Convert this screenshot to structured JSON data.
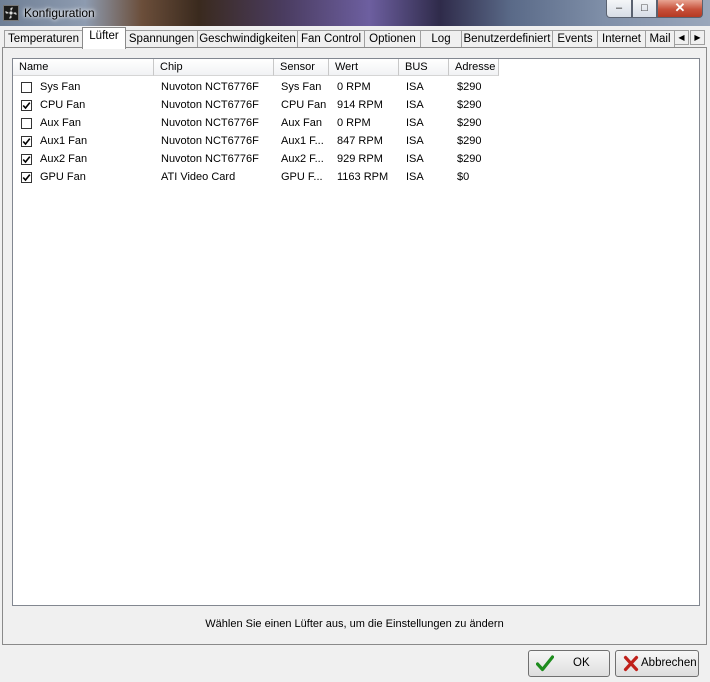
{
  "window": {
    "title": "Konfiguration",
    "minimize": "–",
    "maximize": "□",
    "close": "✕"
  },
  "tabs": [
    {
      "label": "Temperaturen",
      "active": false
    },
    {
      "label": "Lüfter",
      "active": true
    },
    {
      "label": "Spannungen",
      "active": false
    },
    {
      "label": "Geschwindigkeiten",
      "active": false
    },
    {
      "label": "Fan Control",
      "active": false
    },
    {
      "label": "Optionen",
      "active": false
    },
    {
      "label": "Log",
      "active": false
    },
    {
      "label": "Benutzerdefiniert",
      "active": false
    },
    {
      "label": "Events",
      "active": false
    },
    {
      "label": "Internet",
      "active": false
    },
    {
      "label": "Mail",
      "active": false
    }
  ],
  "tab_scroll": {
    "left": "◀",
    "right": "▶"
  },
  "table": {
    "columns": [
      "Name",
      "Chip",
      "Sensor",
      "Wert",
      "BUS",
      "Adresse"
    ],
    "rows": [
      {
        "checked": false,
        "name": "Sys Fan",
        "chip": "Nuvoton NCT6776F",
        "sensor": "Sys Fan",
        "wert": "0 RPM",
        "bus": "ISA",
        "adresse": "$290"
      },
      {
        "checked": true,
        "name": "CPU Fan",
        "chip": "Nuvoton NCT6776F",
        "sensor": "CPU Fan",
        "wert": "914 RPM",
        "bus": "ISA",
        "adresse": "$290"
      },
      {
        "checked": false,
        "name": "Aux Fan",
        "chip": "Nuvoton NCT6776F",
        "sensor": "Aux Fan",
        "wert": "0 RPM",
        "bus": "ISA",
        "adresse": "$290"
      },
      {
        "checked": true,
        "name": "Aux1 Fan",
        "chip": "Nuvoton NCT6776F",
        "sensor": "Aux1 F...",
        "wert": "847 RPM",
        "bus": "ISA",
        "adresse": "$290"
      },
      {
        "checked": true,
        "name": "Aux2 Fan",
        "chip": "Nuvoton NCT6776F",
        "sensor": "Aux2 F...",
        "wert": "929 RPM",
        "bus": "ISA",
        "adresse": "$290"
      },
      {
        "checked": true,
        "name": "GPU Fan",
        "chip": "ATI Video Card",
        "sensor": "GPU F...",
        "wert": "1163 RPM",
        "bus": "ISA",
        "adresse": "$0"
      }
    ]
  },
  "hint": "Wählen Sie einen Lüfter aus, um die Einstellungen zu ändern",
  "buttons": {
    "ok": "OK",
    "cancel": "Abbrechen"
  },
  "colors": {
    "ok_check": "#1e8c1e",
    "cancel_x": "#c0201a"
  }
}
